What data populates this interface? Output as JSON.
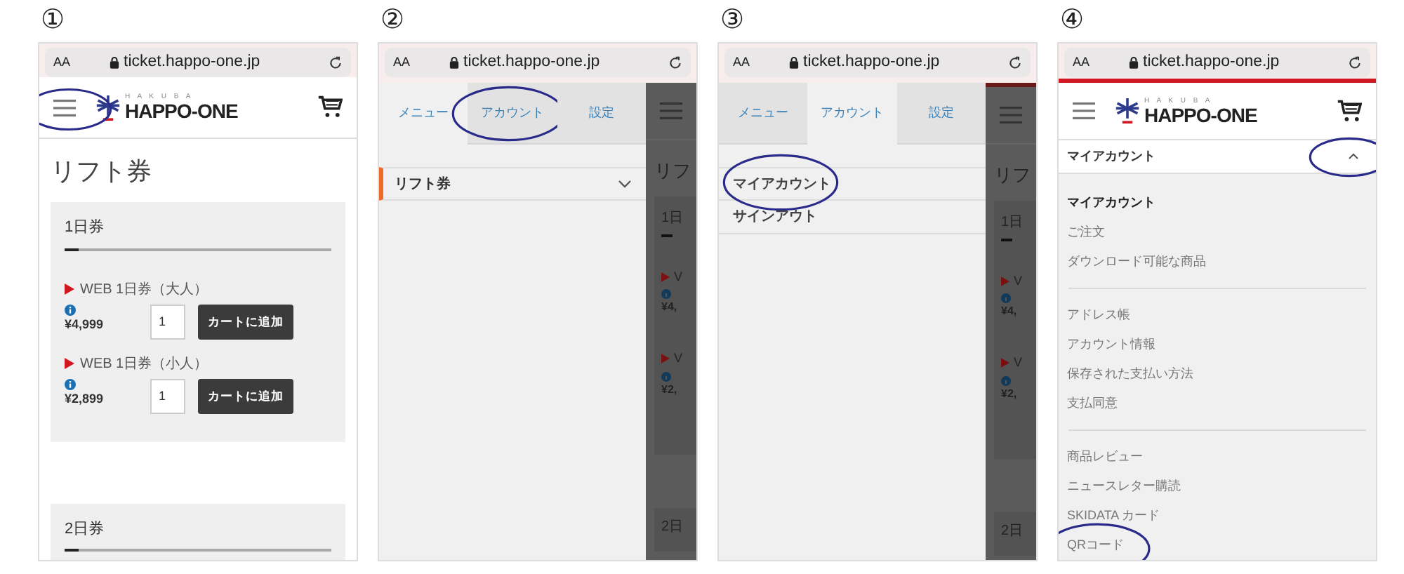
{
  "panels": [
    {
      "kind": "page",
      "step": "①",
      "browser": {
        "text_size": "AA",
        "address": "ticket.happo-one.jp"
      },
      "header": {
        "brand_small": "H A K U B A",
        "brand": "HAPPO-ONE",
        "menu_circled": true
      },
      "page_title": "リフト券",
      "sections": [
        {
          "title": "1日券",
          "products": [
            {
              "name": "WEB 1日券（大人）",
              "price": "¥4,999",
              "quantity": "1",
              "button": "カートに追加"
            },
            {
              "name": "WEB 1日券（小人）",
              "price": "¥2,899",
              "quantity": "1",
              "button": "カートに追加"
            }
          ]
        },
        {
          "title": "2日券"
        }
      ]
    },
    {
      "kind": "drawer",
      "step": "②",
      "browser": {
        "text_size": "AA",
        "address": "ticket.happo-one.jp"
      },
      "tabs": [
        {
          "label": "メニュー",
          "selected": true,
          "circled": false
        },
        {
          "label": "アカウント",
          "selected": false,
          "circled": true
        },
        {
          "label": "設定",
          "selected": false,
          "circled": false
        }
      ],
      "items": [
        {
          "label": "リフト券",
          "kind": "category",
          "circled": false
        }
      ],
      "backdrop": {
        "title": "リフ",
        "sections": [
          "1日",
          "2日"
        ],
        "products": [
          {
            "name": "V",
            "price": "¥4,"
          },
          {
            "name": "V",
            "price": "¥2,"
          }
        ]
      }
    },
    {
      "kind": "drawer",
      "step": "③",
      "browser": {
        "text_size": "AA",
        "address": "ticket.happo-one.jp"
      },
      "tabs": [
        {
          "label": "メニュー",
          "selected": false,
          "circled": false
        },
        {
          "label": "アカウント",
          "selected": true,
          "circled": false
        },
        {
          "label": "設定",
          "selected": false,
          "circled": false
        }
      ],
      "items": [
        {
          "label": "マイアカウント",
          "kind": "link",
          "circled": true
        },
        {
          "label": "サインアウト",
          "kind": "link",
          "circled": false
        }
      ],
      "backdrop": {
        "accent_line": true,
        "title": "リフ",
        "sections": [
          "1日",
          "2日"
        ],
        "products": [
          {
            "name": "V",
            "price": "¥4,"
          },
          {
            "name": "V",
            "price": "¥2,"
          }
        ]
      }
    },
    {
      "kind": "account",
      "step": "④",
      "browser": {
        "text_size": "AA",
        "address": "ticket.happo-one.jp"
      },
      "header": {
        "brand_small": "H A K U B A",
        "brand": "HAPPO-ONE",
        "accent_line": true
      },
      "accordion": {
        "title": "マイアカウント",
        "expanded": true,
        "circled": true
      },
      "groups": [
        [
          {
            "label": "マイアカウント",
            "selected": true,
            "circled": false
          },
          {
            "label": "ご注文",
            "selected": false,
            "circled": false
          },
          {
            "label": "ダウンロード可能な商品",
            "selected": false,
            "circled": false
          }
        ],
        [
          {
            "label": "アドレス帳",
            "selected": false,
            "circled": false
          },
          {
            "label": "アカウント情報",
            "selected": false,
            "circled": false
          },
          {
            "label": "保存された支払い方法",
            "selected": false,
            "circled": false
          },
          {
            "label": "支払同意",
            "selected": false,
            "circled": false
          }
        ],
        [
          {
            "label": "商品レビュー",
            "selected": false,
            "circled": false
          },
          {
            "label": "ニュースレター購読",
            "selected": false,
            "circled": false
          },
          {
            "label": "SKIDATA カード",
            "selected": false,
            "circled": false
          },
          {
            "label": "QRコード",
            "selected": false,
            "circled": true
          }
        ]
      ]
    }
  ]
}
